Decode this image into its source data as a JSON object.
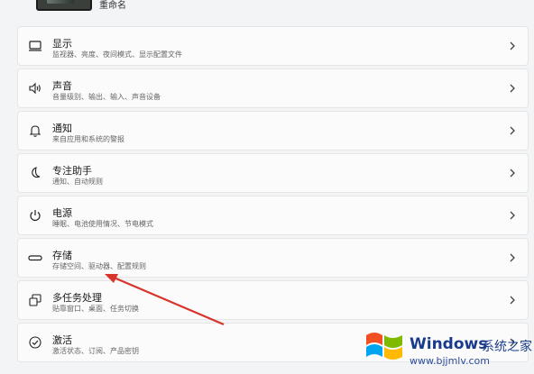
{
  "header": {
    "rename_label": "重命名"
  },
  "items": [
    {
      "title": "显示",
      "subtitle": "监视器、亮度、夜间模式、显示配置文件",
      "icon": "monitor-icon"
    },
    {
      "title": "声音",
      "subtitle": "音量级别、输出、输入、声音设备",
      "icon": "speaker-icon"
    },
    {
      "title": "通知",
      "subtitle": "来自应用和系统的警报",
      "icon": "bell-icon"
    },
    {
      "title": "专注助手",
      "subtitle": "通知、自动规则",
      "icon": "moon-icon"
    },
    {
      "title": "电源",
      "subtitle": "睡眠、电池使用情况、节电模式",
      "icon": "power-icon"
    },
    {
      "title": "存储",
      "subtitle": "存储空间、驱动器、配置规则",
      "icon": "storage-icon"
    },
    {
      "title": "多任务处理",
      "subtitle": "贴靠窗口、桌面、任务切换",
      "icon": "multitask-icon"
    },
    {
      "title": "激活",
      "subtitle": "激活状态、订阅、产品密钥",
      "icon": "check-circle-icon"
    }
  ],
  "watermark": {
    "brand": "Windows",
    "brand_cn": "系统之家",
    "url": "www.bjjmlv.com"
  },
  "colors": {
    "annotation_arrow": "#d9342b",
    "watermark_blue": "#1a3b8c"
  }
}
